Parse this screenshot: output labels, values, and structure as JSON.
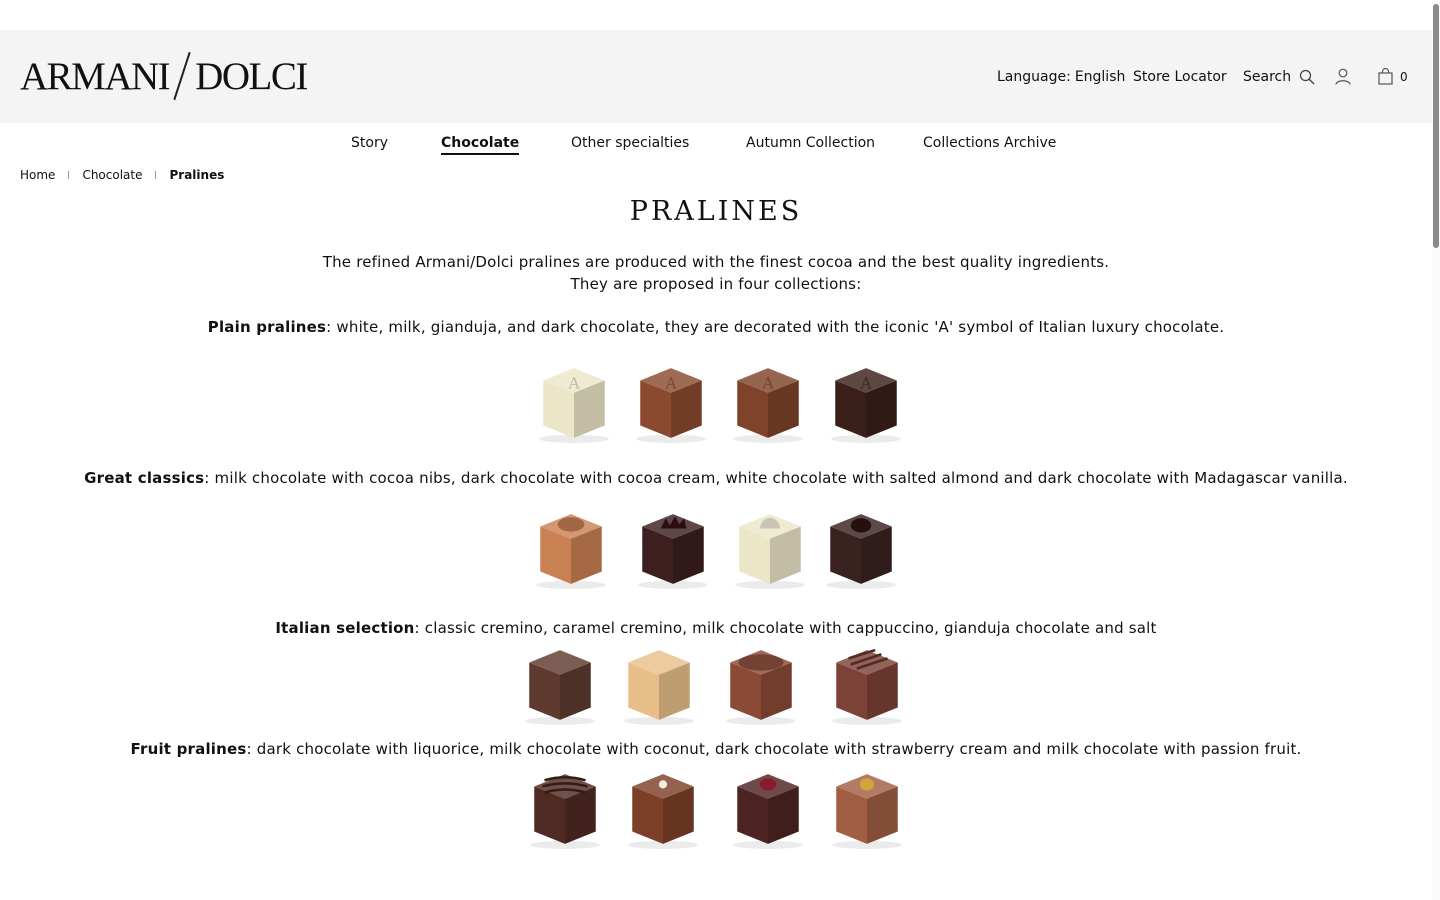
{
  "brand": {
    "logo_left": "ARMANI",
    "logo_right": "DOLCI"
  },
  "header": {
    "language_label": "Language:",
    "language_value": "English",
    "store_locator": "Store Locator",
    "search_label": "Search",
    "cart_count": "0",
    "icons": {
      "search": "search-icon",
      "account": "user-icon",
      "cart": "shopping-bag-icon"
    }
  },
  "nav": {
    "items": [
      "Story",
      "Chocolate",
      "Other specialties",
      "Autumn Collection",
      "Collections Archive"
    ],
    "active": "Chocolate"
  },
  "breadcrumb": [
    "Home",
    "Chocolate",
    "Pralines"
  ],
  "page": {
    "title": "PRALINES",
    "intro_line1": "The refined Armani/Dolci pralines are produced with the finest cocoa and the best quality ingredients.",
    "intro_line2": "They are proposed in four collections:"
  },
  "collections": [
    {
      "name": "Plain pralines",
      "description": ": white, milk, gianduja, and dark chocolate, they are decorated with the iconic 'A' symbol of Italian luxury chocolate.",
      "pralines": [
        {
          "kind": "white chocolate",
          "color": "#ece6c8",
          "topping": "A"
        },
        {
          "kind": "milk chocolate",
          "color": "#8b4a2f",
          "topping": "A"
        },
        {
          "kind": "gianduja chocolate",
          "color": "#7f4329",
          "topping": "A"
        },
        {
          "kind": "dark chocolate",
          "color": "#3b2019",
          "topping": "A"
        }
      ]
    },
    {
      "name": "Great classics",
      "description": ": milk chocolate with cocoa nibs, dark chocolate with cocoa cream, white chocolate with salted almond and dark chocolate with Madagascar vanilla.",
      "pralines": [
        {
          "kind": "milk chocolate with cocoa nibs",
          "color": "#c98052",
          "topping": "bean"
        },
        {
          "kind": "dark chocolate with cocoa cream",
          "color": "#3d1f1f",
          "topping": "nibs"
        },
        {
          "kind": "white chocolate with salted almond",
          "color": "#ece6c8",
          "topping": "almond"
        },
        {
          "kind": "dark chocolate with Madagascar vanilla",
          "color": "#3a2220",
          "topping": "dome"
        }
      ]
    },
    {
      "name": "Italian selection",
      "description": ": classic cremino, caramel cremino, milk chocolate with cappuccino, gianduja chocolate and salt",
      "pralines": [
        {
          "kind": "classic cremino",
          "color": "#5e3a2e",
          "topping": "none"
        },
        {
          "kind": "caramel cremino",
          "color": "#e8bf8a",
          "topping": "none"
        },
        {
          "kind": "milk chocolate with cappuccino",
          "color": "#8b4a36",
          "topping": "dust"
        },
        {
          "kind": "gianduja chocolate and salt",
          "color": "#7c4237",
          "topping": "lines"
        }
      ]
    },
    {
      "name": "Fruit pralines",
      "description": ": dark chocolate with liquorice, milk chocolate with coconut, dark chocolate with strawberry cream and milk chocolate with passion fruit.",
      "pralines": [
        {
          "kind": "dark chocolate with liquorice",
          "color": "#4f2a22",
          "topping": "ridges"
        },
        {
          "kind": "milk chocolate with coconut",
          "color": "#7c3f27",
          "topping": "coconut"
        },
        {
          "kind": "dark chocolate with strawberry cream",
          "color": "#4e2422",
          "topping": "berry"
        },
        {
          "kind": "milk chocolate with passion fruit",
          "color": "#a15e43",
          "topping": "fruit"
        }
      ]
    }
  ]
}
